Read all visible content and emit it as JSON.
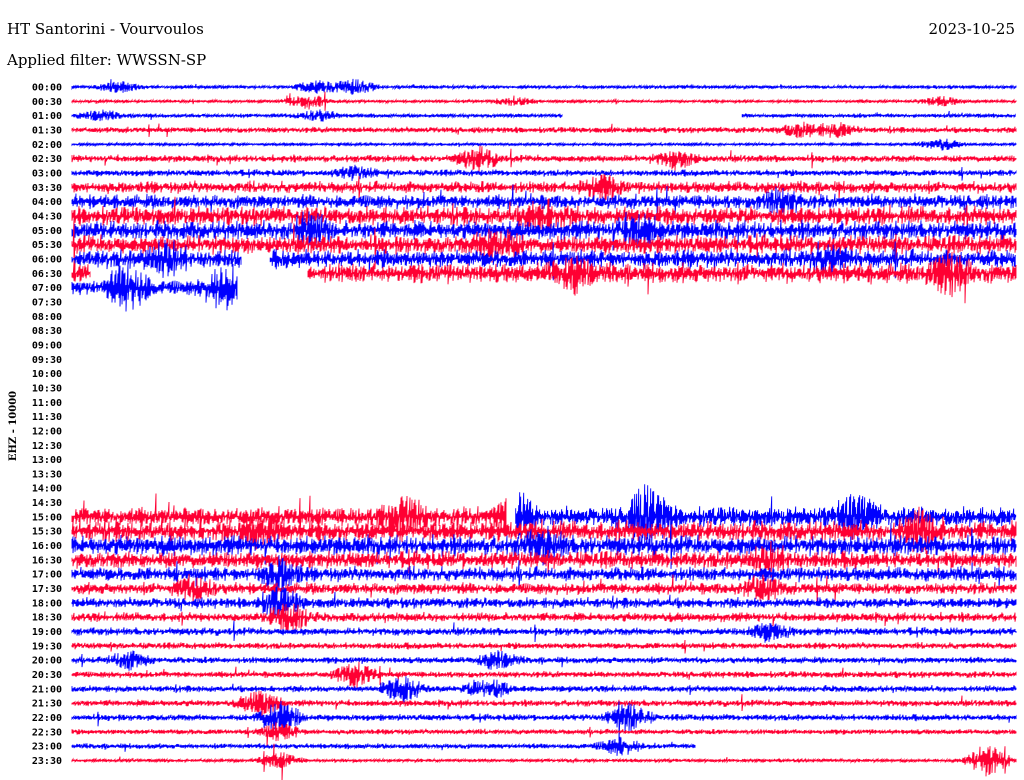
{
  "header": {
    "station": "HT Santorini - Vourvoulos",
    "date": "2023-10-25",
    "filter": "Applied filter: WWSSN-SP"
  },
  "chart_data": {
    "type": "line",
    "title": "HT Santorini - Vourvoulos",
    "ylabel": "EHZ - 10000",
    "xlabel": "",
    "minutes_per_line": 30,
    "colors": {
      "blue": "#0000ff",
      "red": "#ff0033"
    },
    "rows": [
      {
        "label": "00:00",
        "amp": 0.25,
        "segments": [
          [
            0,
            1,
            "blue"
          ]
        ],
        "events": [
          [
            0.05,
            1.0
          ],
          [
            0.26,
            1.2
          ],
          [
            0.3,
            1.4
          ]
        ]
      },
      {
        "label": "00:30",
        "amp": 0.22,
        "segments": [
          [
            0,
            1,
            "red"
          ]
        ],
        "events": [
          [
            0.25,
            1.3
          ],
          [
            0.47,
            0.8
          ],
          [
            0.92,
            0.9
          ]
        ]
      },
      {
        "label": "01:00",
        "amp": 0.3,
        "segments": [
          [
            0,
            0.52,
            "blue"
          ],
          [
            0.71,
            1,
            "blue"
          ]
        ],
        "events": [
          [
            0.03,
            0.9
          ],
          [
            0.26,
            1.0
          ]
        ]
      },
      {
        "label": "01:30",
        "amp": 0.45,
        "segments": [
          [
            0,
            1,
            "red"
          ]
        ],
        "events": [
          [
            0.77,
            1.2
          ],
          [
            0.81,
            1.1
          ]
        ]
      },
      {
        "label": "02:00",
        "amp": 0.22,
        "segments": [
          [
            0,
            1,
            "blue"
          ]
        ],
        "events": [
          [
            0.92,
            1.0
          ]
        ]
      },
      {
        "label": "02:30",
        "amp": 0.55,
        "segments": [
          [
            0,
            1,
            "red"
          ]
        ],
        "events": [
          [
            0.43,
            2.0
          ],
          [
            0.64,
            1.6
          ]
        ]
      },
      {
        "label": "03:00",
        "amp": 0.5,
        "segments": [
          [
            0,
            1,
            "blue"
          ]
        ],
        "events": [
          [
            0.3,
            1.0
          ]
        ]
      },
      {
        "label": "03:30",
        "amp": 0.9,
        "segments": [
          [
            0,
            1,
            "red"
          ]
        ],
        "events": [
          [
            0.56,
            2.0
          ]
        ]
      },
      {
        "label": "04:00",
        "amp": 1.1,
        "segments": [
          [
            0,
            1,
            "blue"
          ]
        ],
        "events": [
          [
            0.75,
            2.0
          ]
        ]
      },
      {
        "label": "04:30",
        "amp": 1.4,
        "segments": [
          [
            0,
            1,
            "red"
          ]
        ],
        "events": [
          [
            0.5,
            2.5
          ]
        ]
      },
      {
        "label": "05:00",
        "amp": 1.4,
        "segments": [
          [
            0,
            1,
            "blue"
          ]
        ],
        "events": [
          [
            0.25,
            2.5
          ],
          [
            0.6,
            2.5
          ]
        ]
      },
      {
        "label": "05:30",
        "amp": 1.4,
        "segments": [
          [
            0,
            1,
            "red"
          ]
        ],
        "events": [
          [
            0.45,
            2.5
          ]
        ]
      },
      {
        "label": "06:00",
        "amp": 1.4,
        "segments": [
          [
            0,
            0.18,
            "blue"
          ],
          [
            0.21,
            1,
            "blue"
          ]
        ],
        "events": [
          [
            0.1,
            2.5
          ],
          [
            0.8,
            2.0
          ]
        ]
      },
      {
        "label": "06:30",
        "amp": 1.5,
        "segments": [
          [
            0,
            0.02,
            "red"
          ],
          [
            0.25,
            1,
            "red"
          ]
        ],
        "events": [
          [
            0.53,
            2.5
          ],
          [
            0.93,
            3.5
          ]
        ]
      },
      {
        "label": "07:00",
        "amp": 1.2,
        "segments": [
          [
            0,
            0.175,
            "blue"
          ]
        ],
        "events": [
          [
            0.06,
            4.0
          ],
          [
            0.16,
            3.0
          ]
        ]
      },
      {
        "label": "07:30",
        "amp": 0,
        "segments": [],
        "events": []
      },
      {
        "label": "08:00",
        "amp": 0,
        "segments": [],
        "events": []
      },
      {
        "label": "08:30",
        "amp": 0,
        "segments": [],
        "events": []
      },
      {
        "label": "09:00",
        "amp": 0,
        "segments": [],
        "events": []
      },
      {
        "label": "09:30",
        "amp": 0,
        "segments": [],
        "events": []
      },
      {
        "label": "10:00",
        "amp": 0,
        "segments": [],
        "events": []
      },
      {
        "label": "10:30",
        "amp": 0,
        "segments": [],
        "events": []
      },
      {
        "label": "11:00",
        "amp": 0,
        "segments": [],
        "events": []
      },
      {
        "label": "11:30",
        "amp": 0,
        "segments": [],
        "events": []
      },
      {
        "label": "12:00",
        "amp": 0,
        "segments": [],
        "events": []
      },
      {
        "label": "12:30",
        "amp": 0,
        "segments": [],
        "events": []
      },
      {
        "label": "13:00",
        "amp": 0,
        "segments": [],
        "events": []
      },
      {
        "label": "13:30",
        "amp": 0,
        "segments": [],
        "events": []
      },
      {
        "label": "14:00",
        "amp": 0,
        "segments": [],
        "events": []
      },
      {
        "label": "14:30",
        "amp": 0,
        "segments": [],
        "events": []
      },
      {
        "label": "15:00",
        "amp": 1.5,
        "segments": [
          [
            0,
            0.46,
            "red"
          ],
          [
            0.47,
            1,
            "blue"
          ]
        ],
        "events": [
          [
            0.35,
            4.0
          ],
          [
            0.47,
            3.5
          ],
          [
            0.61,
            5.0
          ],
          [
            0.83,
            3.5
          ]
        ]
      },
      {
        "label": "15:30",
        "amp": 1.5,
        "segments": [
          [
            0,
            1,
            "red"
          ]
        ],
        "events": [
          [
            0.2,
            2.5
          ],
          [
            0.9,
            3.0
          ]
        ]
      },
      {
        "label": "16:00",
        "amp": 1.5,
        "segments": [
          [
            0,
            1,
            "blue"
          ]
        ],
        "events": [
          [
            0.5,
            2.0
          ]
        ]
      },
      {
        "label": "16:30",
        "amp": 1.3,
        "segments": [
          [
            0,
            1,
            "red"
          ]
        ],
        "events": [
          [
            0.74,
            2.0
          ]
        ]
      },
      {
        "label": "17:00",
        "amp": 1.1,
        "segments": [
          [
            0,
            1,
            "blue"
          ]
        ],
        "events": [
          [
            0.22,
            2.5
          ]
        ]
      },
      {
        "label": "17:30",
        "amp": 0.9,
        "segments": [
          [
            0,
            1,
            "red"
          ]
        ],
        "events": [
          [
            0.13,
            2.0
          ],
          [
            0.73,
            2.0
          ]
        ]
      },
      {
        "label": "18:00",
        "amp": 0.8,
        "segments": [
          [
            0,
            1,
            "blue"
          ]
        ],
        "events": [
          [
            0.22,
            2.5
          ]
        ]
      },
      {
        "label": "18:30",
        "amp": 0.7,
        "segments": [
          [
            0,
            1,
            "red"
          ]
        ],
        "events": [
          [
            0.23,
            2.5
          ]
        ]
      },
      {
        "label": "19:00",
        "amp": 0.6,
        "segments": [
          [
            0,
            1,
            "blue"
          ]
        ],
        "events": [
          [
            0.74,
            1.5
          ]
        ]
      },
      {
        "label": "19:30",
        "amp": 0.5,
        "segments": [
          [
            0,
            1,
            "red"
          ]
        ],
        "events": []
      },
      {
        "label": "20:00",
        "amp": 0.5,
        "segments": [
          [
            0,
            1,
            "blue"
          ]
        ],
        "events": [
          [
            0.06,
            1.5
          ],
          [
            0.45,
            1.5
          ]
        ]
      },
      {
        "label": "20:30",
        "amp": 0.5,
        "segments": [
          [
            0,
            1,
            "red"
          ]
        ],
        "events": [
          [
            0.3,
            2.0
          ]
        ]
      },
      {
        "label": "21:00",
        "amp": 0.5,
        "segments": [
          [
            0,
            1,
            "blue"
          ]
        ],
        "events": [
          [
            0.35,
            2.2
          ],
          [
            0.44,
            2.0
          ]
        ]
      },
      {
        "label": "21:30",
        "amp": 0.5,
        "segments": [
          [
            0,
            1,
            "red"
          ]
        ],
        "events": [
          [
            0.2,
            2.2
          ]
        ]
      },
      {
        "label": "22:00",
        "amp": 0.5,
        "segments": [
          [
            0,
            1,
            "blue"
          ]
        ],
        "events": [
          [
            0.22,
            3.0
          ],
          [
            0.59,
            2.5
          ]
        ]
      },
      {
        "label": "22:30",
        "amp": 0.4,
        "segments": [
          [
            0,
            1,
            "red"
          ]
        ],
        "events": [
          [
            0.22,
            1.5
          ]
        ]
      },
      {
        "label": "23:00",
        "amp": 0.4,
        "segments": [
          [
            0,
            0.66,
            "blue"
          ]
        ],
        "events": [
          [
            0.58,
            1.5
          ]
        ]
      },
      {
        "label": "23:30",
        "amp": 0.25,
        "segments": [
          [
            0,
            1,
            "red"
          ]
        ],
        "events": [
          [
            0.22,
            1.5
          ],
          [
            0.97,
            3.0
          ]
        ]
      }
    ]
  }
}
